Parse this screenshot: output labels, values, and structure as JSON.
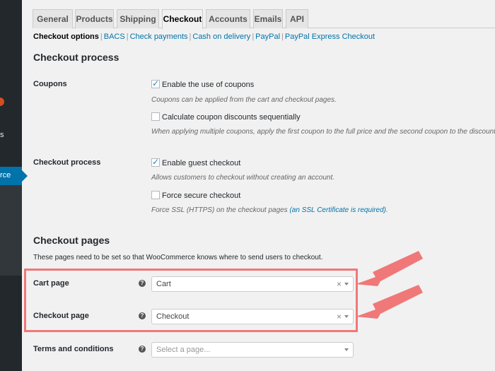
{
  "sidebar": {
    "fragment_s": "s",
    "active_fragment": "rce"
  },
  "tabs": [
    "General",
    "Products",
    "Shipping",
    "Checkout",
    "Accounts",
    "Emails",
    "API"
  ],
  "active_tab": "Checkout",
  "subnav": {
    "current": "Checkout options",
    "links": [
      "BACS",
      "Check payments",
      "Cash on delivery",
      "PayPal",
      "PayPal Express Checkout"
    ]
  },
  "checkout_process": {
    "heading": "Checkout process",
    "coupons": {
      "label": "Coupons",
      "enable_label": "Enable the use of coupons",
      "enable_checked": true,
      "enable_desc": "Coupons can be applied from the cart and checkout pages.",
      "sequential_label": "Calculate coupon discounts sequentially",
      "sequential_checked": false,
      "sequential_desc": "When applying multiple coupons, apply the first coupon to the full price and the second coupon to the discounted"
    },
    "process": {
      "label": "Checkout process",
      "guest_label": "Enable guest checkout",
      "guest_checked": true,
      "guest_desc": "Allows customers to checkout without creating an account.",
      "secure_label": "Force secure checkout",
      "secure_checked": false,
      "secure_desc_prefix": "Force SSL (HTTPS) on the checkout pages ",
      "secure_desc_link": "(an SSL Certificate is required)",
      "secure_desc_suffix": "."
    }
  },
  "checkout_pages": {
    "heading": "Checkout pages",
    "intro": "These pages need to be set so that WooCommerce knows where to send users to checkout.",
    "cart": {
      "label": "Cart page",
      "value": "Cart"
    },
    "checkout": {
      "label": "Checkout page",
      "value": "Checkout"
    },
    "terms": {
      "label": "Terms and conditions",
      "placeholder": "Select a page..."
    }
  },
  "icons": {
    "help": "?",
    "clear": "×"
  },
  "colors": {
    "accent": "#0073aa",
    "highlight": "#f07878",
    "sidebar": "#23282d"
  }
}
